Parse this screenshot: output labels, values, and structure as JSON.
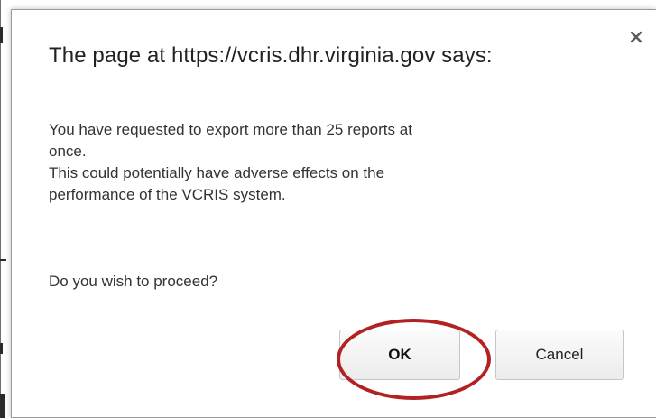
{
  "dialog": {
    "title": "The page at https://vcris.dhr.virginia.gov says:",
    "message_lines": [
      "You have requested to export more than 25 reports at",
      "once.",
      "This could potentially have adverse effects on the",
      "performance of the VCRIS system."
    ],
    "prompt": "Do you wish to proceed?",
    "ok_label": "OK",
    "cancel_label": "Cancel",
    "close_icon": "close-icon"
  },
  "annotation": {
    "highlight_color": "#b32222"
  }
}
